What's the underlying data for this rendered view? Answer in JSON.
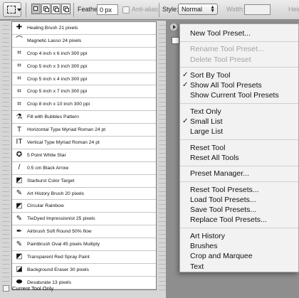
{
  "options_bar": {
    "feather_label": "Feather:",
    "feather_value": "0 px",
    "antialias_label": "Anti-alias",
    "style_label": "Style:",
    "style_value": "Normal",
    "width_label": "Width:",
    "height_label": "Heig"
  },
  "preset_list": {
    "items": [
      {
        "label": "Healing Brush 21 pixels",
        "icon": "healing-brush-icon",
        "glyph": "✚"
      },
      {
        "label": "Magnetic Lasso 24 pixels",
        "icon": "magnetic-lasso-icon",
        "glyph": "⌒"
      },
      {
        "label": "Crop 4 inch x 6 inch 300 ppi",
        "icon": "crop-icon",
        "glyph": "⌗"
      },
      {
        "label": "Crop 5 inch x 3 inch 300 ppi",
        "icon": "crop-icon",
        "glyph": "⌗"
      },
      {
        "label": "Crop 5 inch x 4 inch 300 ppi",
        "icon": "crop-icon",
        "glyph": "⌗"
      },
      {
        "label": "Crop 5 inch x 7 inch 300 ppi",
        "icon": "crop-icon",
        "glyph": "⌗"
      },
      {
        "label": "Crop 8 inch x 10 inch 300 ppi",
        "icon": "crop-icon",
        "glyph": "⌗"
      },
      {
        "label": "Fill with Bubbles Pattern",
        "icon": "paint-bucket-icon",
        "glyph": "⚗"
      },
      {
        "label": "Horizontal Type Myriad Roman 24 pt",
        "icon": "horizontal-type-icon",
        "glyph": "T"
      },
      {
        "label": "Vertical Type Myriad Roman 24 pt",
        "icon": "vertical-type-icon",
        "glyph": "IT"
      },
      {
        "label": "5 Point White Star",
        "icon": "star-shape-icon",
        "glyph": "✪"
      },
      {
        "label": "0.5 cm Black Arrow",
        "icon": "line-arrow-icon",
        "glyph": "/"
      },
      {
        "label": "Starburst Color Target",
        "icon": "gradient-icon",
        "glyph": "◩"
      },
      {
        "label": "Art History Brush 20 pixels",
        "icon": "art-history-brush-icon",
        "glyph": "✎"
      },
      {
        "label": "Circular Rainbow",
        "icon": "gradient-icon",
        "glyph": "◩"
      },
      {
        "label": "TieDyed Impressionist 25 pixels",
        "icon": "art-history-brush-icon",
        "glyph": "✎"
      },
      {
        "label": "Airbrush Soft Round 50% flow",
        "icon": "airbrush-icon",
        "glyph": "✒"
      },
      {
        "label": "Paintbrush Oval 45 pixels Multiply",
        "icon": "paintbrush-icon",
        "glyph": "✎"
      },
      {
        "label": "Transparent Red Spray Paint",
        "icon": "gradient-icon",
        "glyph": "◩"
      },
      {
        "label": "Background Eraser 30 pixels",
        "icon": "background-eraser-icon",
        "glyph": "◪"
      },
      {
        "label": "Desaturate 13 pixels",
        "icon": "sponge-icon",
        "glyph": "⬬"
      }
    ],
    "footer_label": "Current Tool Only"
  },
  "menu": {
    "groups": [
      [
        {
          "label": "New Tool Preset...",
          "enabled": true,
          "checked": false
        }
      ],
      [
        {
          "label": "Rename Tool Preset...",
          "enabled": false,
          "checked": false
        },
        {
          "label": "Delete Tool Preset",
          "enabled": false,
          "checked": false
        }
      ],
      [
        {
          "label": "Sort By Tool",
          "enabled": true,
          "checked": true
        },
        {
          "label": "Show All Tool Presets",
          "enabled": true,
          "checked": true
        },
        {
          "label": "Show Current Tool Presets",
          "enabled": true,
          "checked": false
        }
      ],
      [
        {
          "label": "Text Only",
          "enabled": true,
          "checked": false
        },
        {
          "label": "Small List",
          "enabled": true,
          "checked": true
        },
        {
          "label": "Large List",
          "enabled": true,
          "checked": false
        }
      ],
      [
        {
          "label": "Reset Tool",
          "enabled": true,
          "checked": false
        },
        {
          "label": "Reset All Tools",
          "enabled": true,
          "checked": false
        }
      ],
      [
        {
          "label": "Preset Manager...",
          "enabled": true,
          "checked": false
        }
      ],
      [
        {
          "label": "Reset Tool Presets...",
          "enabled": true,
          "checked": false
        },
        {
          "label": "Load Tool Presets...",
          "enabled": true,
          "checked": false
        },
        {
          "label": "Save Tool Presets...",
          "enabled": true,
          "checked": false
        },
        {
          "label": "Replace Tool Presets...",
          "enabled": true,
          "checked": false
        }
      ],
      [
        {
          "label": "Art History",
          "enabled": true,
          "checked": false
        },
        {
          "label": "Brushes",
          "enabled": true,
          "checked": false
        },
        {
          "label": "Crop and Marquee",
          "enabled": true,
          "checked": false
        },
        {
          "label": "Text",
          "enabled": true,
          "checked": false
        }
      ]
    ]
  },
  "colors": {
    "panel_bg": "#d6d6d6",
    "menu_bg": "#f2f2f2",
    "disabled_text": "#a3a3a3"
  }
}
